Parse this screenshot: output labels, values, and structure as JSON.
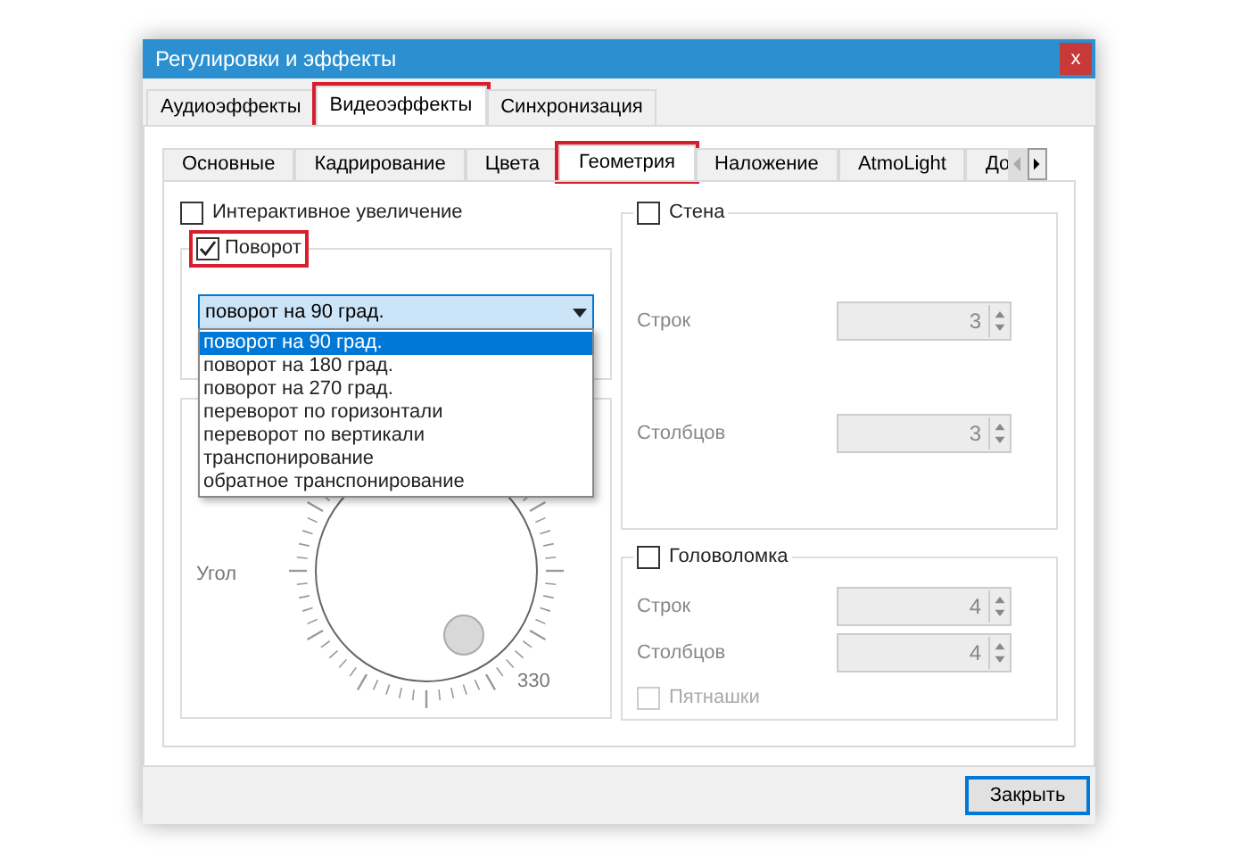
{
  "window": {
    "title": "Регулировки и эффекты",
    "close": "x"
  },
  "tabs": [
    {
      "label": "Аудиоэффекты",
      "selected": false,
      "highlighted": false
    },
    {
      "label": "Видеоэффекты",
      "selected": true,
      "highlighted": true
    },
    {
      "label": "Синхронизация",
      "selected": false,
      "highlighted": false
    }
  ],
  "subtabs": [
    {
      "label": "Основные",
      "selected": false,
      "highlighted": false
    },
    {
      "label": "Кадрирование",
      "selected": false,
      "highlighted": false
    },
    {
      "label": "Цвета",
      "selected": false,
      "highlighted": false
    },
    {
      "label": "Геометрия",
      "selected": true,
      "highlighted": true
    },
    {
      "label": "Наложение",
      "selected": false,
      "highlighted": false
    },
    {
      "label": "AtmoLight",
      "selected": false,
      "highlighted": false
    },
    {
      "label": "До",
      "selected": false,
      "highlighted": false
    }
  ],
  "interactive_zoom": {
    "label": "Интерактивное увеличение",
    "checked": false
  },
  "rotate": {
    "label": "Поворот",
    "checked": true,
    "highlighted": true,
    "combo": {
      "value": "поворот на 90 град.",
      "options": [
        {
          "label": "поворот на 90 град.",
          "selected": true
        },
        {
          "label": "поворот на 180 град.",
          "selected": false
        },
        {
          "label": "поворот на 270 град.",
          "selected": false
        },
        {
          "label": "переворот по горизонтали",
          "selected": false
        },
        {
          "label": "переворот по вертикали",
          "selected": false
        },
        {
          "label": "транспонирование",
          "selected": false
        },
        {
          "label": "обратное транспонирование",
          "selected": false
        }
      ]
    },
    "angle_label": "Угол",
    "dial_reading": "330"
  },
  "wall": {
    "label": "Стена",
    "checked": false,
    "rows_label": "Строк",
    "rows": "3",
    "cols_label": "Столбцов",
    "cols": "3"
  },
  "puzzle": {
    "label": "Головоломка",
    "checked": false,
    "rows_label": "Строк",
    "rows": "4",
    "cols_label": "Столбцов",
    "cols": "4",
    "fifteen": {
      "label": "Пятнашки",
      "checked": false
    }
  },
  "close_button": "Закрыть"
}
